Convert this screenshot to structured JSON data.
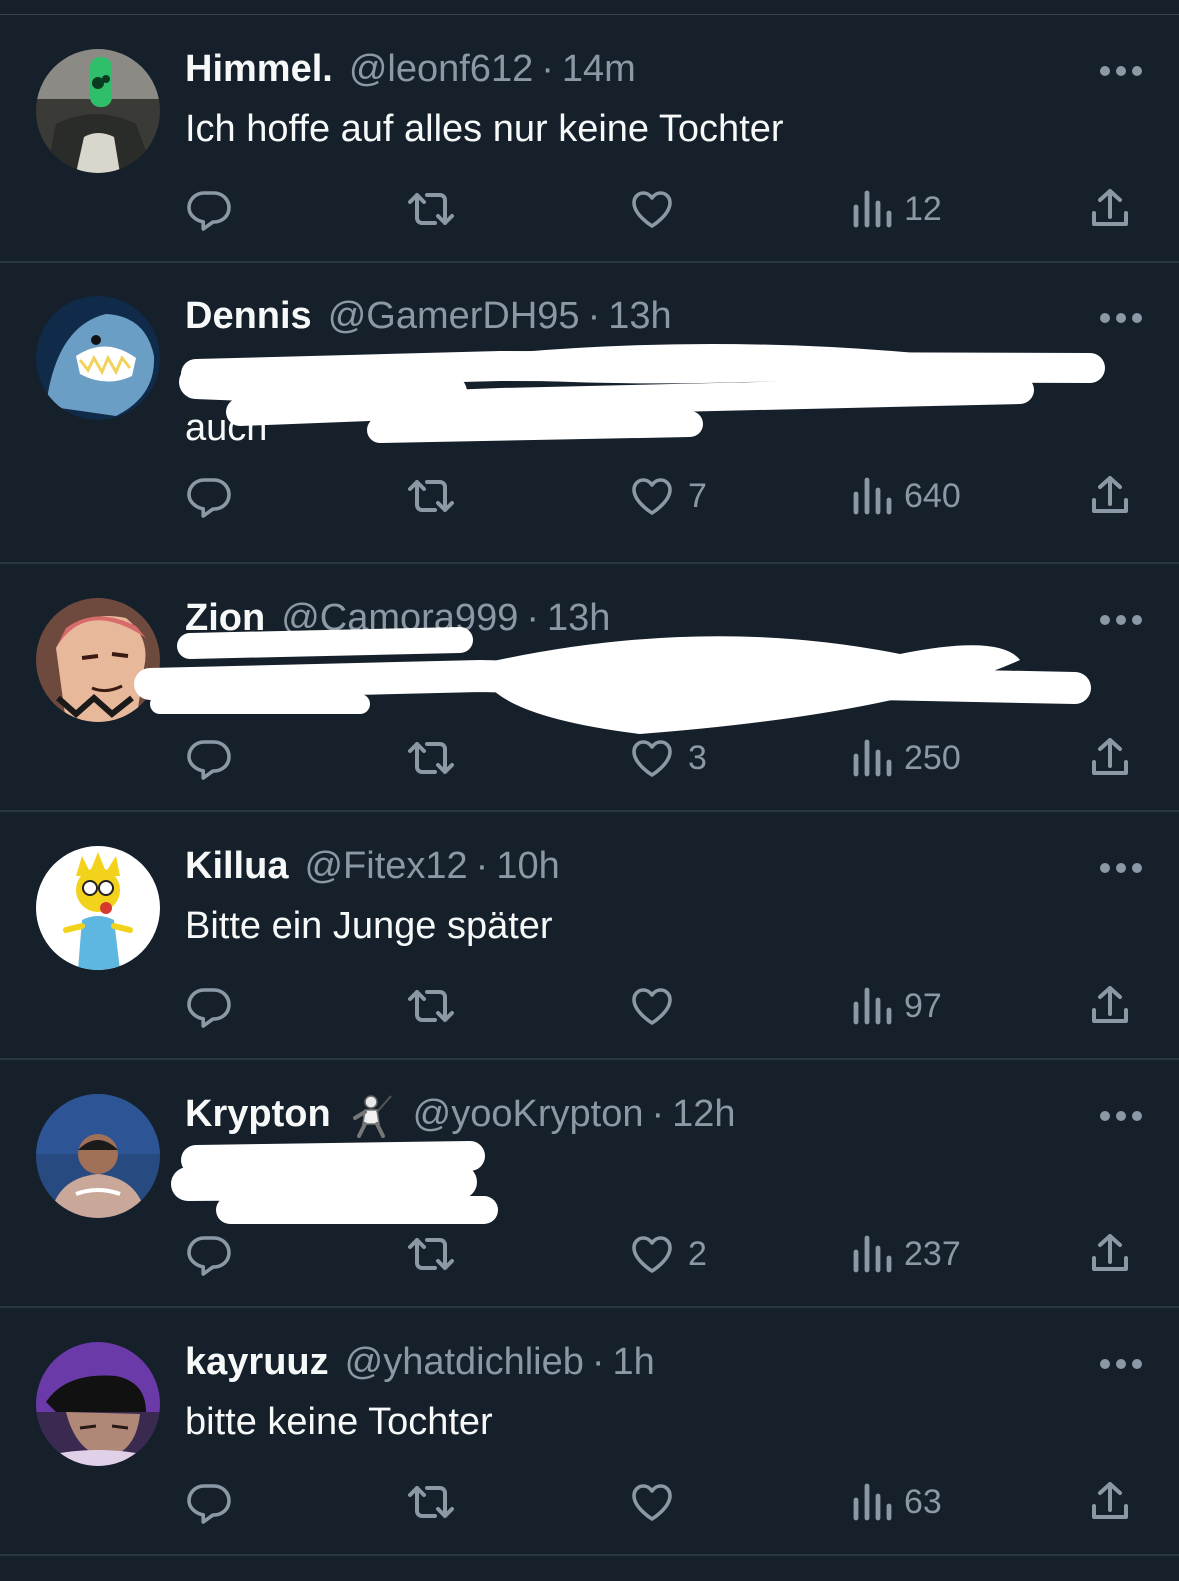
{
  "colors": {
    "background": "#15202b",
    "text_primary": "#f7f9f9",
    "text_secondary": "#8b98a5",
    "divider": "#2a3640",
    "redaction": "#ffffff"
  },
  "icons": {
    "reply": "reply-icon",
    "retweet": "retweet-icon",
    "like": "heart-icon",
    "views": "views-icon",
    "share": "share-icon",
    "more": "more-icon"
  },
  "tweets": [
    {
      "name": "Himmel.",
      "handle": "@leonf612",
      "separator": "·",
      "time": "14m",
      "text": "Ich hoffe auf alles nur keine Tochter",
      "likes": "",
      "views": "12",
      "avatar": "green-bottle-photo"
    },
    {
      "name": "Dennis",
      "handle": "@GamerDH95",
      "separator": "·",
      "time": "13h",
      "text": "\nauch",
      "likes": "7",
      "views": "640",
      "avatar": "shark-photo"
    },
    {
      "name": "Zion",
      "handle": "@Camora999",
      "separator": "·",
      "time": "13h",
      "text": "",
      "likes": "3",
      "views": "250",
      "avatar": "anime-character"
    },
    {
      "name": "Killua",
      "handle": "@Fitex12",
      "separator": "·",
      "time": "10h",
      "text": "Bitte ein Junge später",
      "likes": "",
      "views": "97",
      "avatar": "cartoon-baby"
    },
    {
      "name": "Krypton",
      "handle": "@yooKrypton",
      "separator": "·",
      "time": "12h",
      "text": "",
      "likes": "2",
      "views": "237",
      "avatar": "person-photo",
      "badge": "fencer-emoji"
    },
    {
      "name": "kayruuz",
      "handle": "@yhatdichlieb",
      "separator": "·",
      "time": "1h",
      "text": "bitte keine Tochter",
      "likes": "",
      "views": "63",
      "avatar": "person-cap-photo"
    }
  ]
}
